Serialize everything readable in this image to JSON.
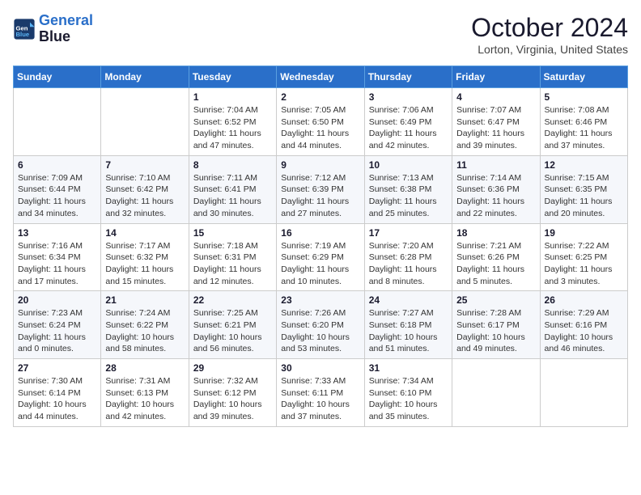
{
  "header": {
    "logo_line1": "General",
    "logo_line2": "Blue",
    "month": "October 2024",
    "location": "Lorton, Virginia, United States"
  },
  "weekdays": [
    "Sunday",
    "Monday",
    "Tuesday",
    "Wednesday",
    "Thursday",
    "Friday",
    "Saturday"
  ],
  "rows": [
    [
      {
        "day": "",
        "info": ""
      },
      {
        "day": "",
        "info": ""
      },
      {
        "day": "1",
        "info": "Sunrise: 7:04 AM\nSunset: 6:52 PM\nDaylight: 11 hours and 47 minutes."
      },
      {
        "day": "2",
        "info": "Sunrise: 7:05 AM\nSunset: 6:50 PM\nDaylight: 11 hours and 44 minutes."
      },
      {
        "day": "3",
        "info": "Sunrise: 7:06 AM\nSunset: 6:49 PM\nDaylight: 11 hours and 42 minutes."
      },
      {
        "day": "4",
        "info": "Sunrise: 7:07 AM\nSunset: 6:47 PM\nDaylight: 11 hours and 39 minutes."
      },
      {
        "day": "5",
        "info": "Sunrise: 7:08 AM\nSunset: 6:46 PM\nDaylight: 11 hours and 37 minutes."
      }
    ],
    [
      {
        "day": "6",
        "info": "Sunrise: 7:09 AM\nSunset: 6:44 PM\nDaylight: 11 hours and 34 minutes."
      },
      {
        "day": "7",
        "info": "Sunrise: 7:10 AM\nSunset: 6:42 PM\nDaylight: 11 hours and 32 minutes."
      },
      {
        "day": "8",
        "info": "Sunrise: 7:11 AM\nSunset: 6:41 PM\nDaylight: 11 hours and 30 minutes."
      },
      {
        "day": "9",
        "info": "Sunrise: 7:12 AM\nSunset: 6:39 PM\nDaylight: 11 hours and 27 minutes."
      },
      {
        "day": "10",
        "info": "Sunrise: 7:13 AM\nSunset: 6:38 PM\nDaylight: 11 hours and 25 minutes."
      },
      {
        "day": "11",
        "info": "Sunrise: 7:14 AM\nSunset: 6:36 PM\nDaylight: 11 hours and 22 minutes."
      },
      {
        "day": "12",
        "info": "Sunrise: 7:15 AM\nSunset: 6:35 PM\nDaylight: 11 hours and 20 minutes."
      }
    ],
    [
      {
        "day": "13",
        "info": "Sunrise: 7:16 AM\nSunset: 6:34 PM\nDaylight: 11 hours and 17 minutes."
      },
      {
        "day": "14",
        "info": "Sunrise: 7:17 AM\nSunset: 6:32 PM\nDaylight: 11 hours and 15 minutes."
      },
      {
        "day": "15",
        "info": "Sunrise: 7:18 AM\nSunset: 6:31 PM\nDaylight: 11 hours and 12 minutes."
      },
      {
        "day": "16",
        "info": "Sunrise: 7:19 AM\nSunset: 6:29 PM\nDaylight: 11 hours and 10 minutes."
      },
      {
        "day": "17",
        "info": "Sunrise: 7:20 AM\nSunset: 6:28 PM\nDaylight: 11 hours and 8 minutes."
      },
      {
        "day": "18",
        "info": "Sunrise: 7:21 AM\nSunset: 6:26 PM\nDaylight: 11 hours and 5 minutes."
      },
      {
        "day": "19",
        "info": "Sunrise: 7:22 AM\nSunset: 6:25 PM\nDaylight: 11 hours and 3 minutes."
      }
    ],
    [
      {
        "day": "20",
        "info": "Sunrise: 7:23 AM\nSunset: 6:24 PM\nDaylight: 11 hours and 0 minutes."
      },
      {
        "day": "21",
        "info": "Sunrise: 7:24 AM\nSunset: 6:22 PM\nDaylight: 10 hours and 58 minutes."
      },
      {
        "day": "22",
        "info": "Sunrise: 7:25 AM\nSunset: 6:21 PM\nDaylight: 10 hours and 56 minutes."
      },
      {
        "day": "23",
        "info": "Sunrise: 7:26 AM\nSunset: 6:20 PM\nDaylight: 10 hours and 53 minutes."
      },
      {
        "day": "24",
        "info": "Sunrise: 7:27 AM\nSunset: 6:18 PM\nDaylight: 10 hours and 51 minutes."
      },
      {
        "day": "25",
        "info": "Sunrise: 7:28 AM\nSunset: 6:17 PM\nDaylight: 10 hours and 49 minutes."
      },
      {
        "day": "26",
        "info": "Sunrise: 7:29 AM\nSunset: 6:16 PM\nDaylight: 10 hours and 46 minutes."
      }
    ],
    [
      {
        "day": "27",
        "info": "Sunrise: 7:30 AM\nSunset: 6:14 PM\nDaylight: 10 hours and 44 minutes."
      },
      {
        "day": "28",
        "info": "Sunrise: 7:31 AM\nSunset: 6:13 PM\nDaylight: 10 hours and 42 minutes."
      },
      {
        "day": "29",
        "info": "Sunrise: 7:32 AM\nSunset: 6:12 PM\nDaylight: 10 hours and 39 minutes."
      },
      {
        "day": "30",
        "info": "Sunrise: 7:33 AM\nSunset: 6:11 PM\nDaylight: 10 hours and 37 minutes."
      },
      {
        "day": "31",
        "info": "Sunrise: 7:34 AM\nSunset: 6:10 PM\nDaylight: 10 hours and 35 minutes."
      },
      {
        "day": "",
        "info": ""
      },
      {
        "day": "",
        "info": ""
      }
    ]
  ]
}
